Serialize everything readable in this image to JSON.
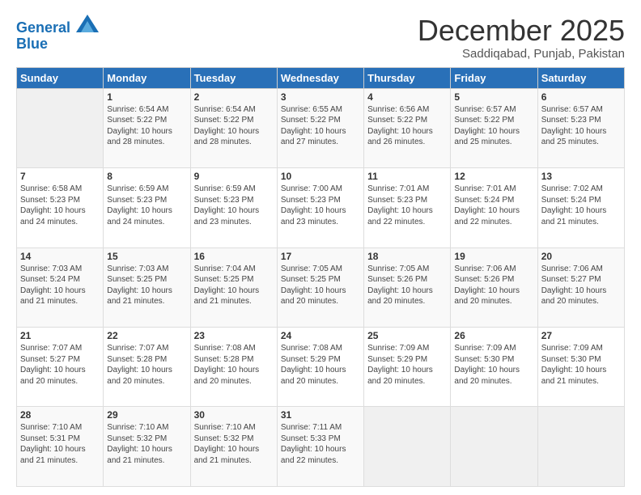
{
  "logo": {
    "line1": "General",
    "line2": "Blue"
  },
  "title": "December 2025",
  "subtitle": "Saddiqabad, Punjab, Pakistan",
  "weekdays": [
    "Sunday",
    "Monday",
    "Tuesday",
    "Wednesday",
    "Thursday",
    "Friday",
    "Saturday"
  ],
  "weeks": [
    [
      {
        "num": "",
        "content": ""
      },
      {
        "num": "1",
        "content": "Sunrise: 6:54 AM\nSunset: 5:22 PM\nDaylight: 10 hours\nand 28 minutes."
      },
      {
        "num": "2",
        "content": "Sunrise: 6:54 AM\nSunset: 5:22 PM\nDaylight: 10 hours\nand 28 minutes."
      },
      {
        "num": "3",
        "content": "Sunrise: 6:55 AM\nSunset: 5:22 PM\nDaylight: 10 hours\nand 27 minutes."
      },
      {
        "num": "4",
        "content": "Sunrise: 6:56 AM\nSunset: 5:22 PM\nDaylight: 10 hours\nand 26 minutes."
      },
      {
        "num": "5",
        "content": "Sunrise: 6:57 AM\nSunset: 5:22 PM\nDaylight: 10 hours\nand 25 minutes."
      },
      {
        "num": "6",
        "content": "Sunrise: 6:57 AM\nSunset: 5:23 PM\nDaylight: 10 hours\nand 25 minutes."
      }
    ],
    [
      {
        "num": "7",
        "content": "Sunrise: 6:58 AM\nSunset: 5:23 PM\nDaylight: 10 hours\nand 24 minutes."
      },
      {
        "num": "8",
        "content": "Sunrise: 6:59 AM\nSunset: 5:23 PM\nDaylight: 10 hours\nand 24 minutes."
      },
      {
        "num": "9",
        "content": "Sunrise: 6:59 AM\nSunset: 5:23 PM\nDaylight: 10 hours\nand 23 minutes."
      },
      {
        "num": "10",
        "content": "Sunrise: 7:00 AM\nSunset: 5:23 PM\nDaylight: 10 hours\nand 23 minutes."
      },
      {
        "num": "11",
        "content": "Sunrise: 7:01 AM\nSunset: 5:23 PM\nDaylight: 10 hours\nand 22 minutes."
      },
      {
        "num": "12",
        "content": "Sunrise: 7:01 AM\nSunset: 5:24 PM\nDaylight: 10 hours\nand 22 minutes."
      },
      {
        "num": "13",
        "content": "Sunrise: 7:02 AM\nSunset: 5:24 PM\nDaylight: 10 hours\nand 21 minutes."
      }
    ],
    [
      {
        "num": "14",
        "content": "Sunrise: 7:03 AM\nSunset: 5:24 PM\nDaylight: 10 hours\nand 21 minutes."
      },
      {
        "num": "15",
        "content": "Sunrise: 7:03 AM\nSunset: 5:25 PM\nDaylight: 10 hours\nand 21 minutes."
      },
      {
        "num": "16",
        "content": "Sunrise: 7:04 AM\nSunset: 5:25 PM\nDaylight: 10 hours\nand 21 minutes."
      },
      {
        "num": "17",
        "content": "Sunrise: 7:05 AM\nSunset: 5:25 PM\nDaylight: 10 hours\nand 20 minutes."
      },
      {
        "num": "18",
        "content": "Sunrise: 7:05 AM\nSunset: 5:26 PM\nDaylight: 10 hours\nand 20 minutes."
      },
      {
        "num": "19",
        "content": "Sunrise: 7:06 AM\nSunset: 5:26 PM\nDaylight: 10 hours\nand 20 minutes."
      },
      {
        "num": "20",
        "content": "Sunrise: 7:06 AM\nSunset: 5:27 PM\nDaylight: 10 hours\nand 20 minutes."
      }
    ],
    [
      {
        "num": "21",
        "content": "Sunrise: 7:07 AM\nSunset: 5:27 PM\nDaylight: 10 hours\nand 20 minutes."
      },
      {
        "num": "22",
        "content": "Sunrise: 7:07 AM\nSunset: 5:28 PM\nDaylight: 10 hours\nand 20 minutes."
      },
      {
        "num": "23",
        "content": "Sunrise: 7:08 AM\nSunset: 5:28 PM\nDaylight: 10 hours\nand 20 minutes."
      },
      {
        "num": "24",
        "content": "Sunrise: 7:08 AM\nSunset: 5:29 PM\nDaylight: 10 hours\nand 20 minutes."
      },
      {
        "num": "25",
        "content": "Sunrise: 7:09 AM\nSunset: 5:29 PM\nDaylight: 10 hours\nand 20 minutes."
      },
      {
        "num": "26",
        "content": "Sunrise: 7:09 AM\nSunset: 5:30 PM\nDaylight: 10 hours\nand 20 minutes."
      },
      {
        "num": "27",
        "content": "Sunrise: 7:09 AM\nSunset: 5:30 PM\nDaylight: 10 hours\nand 21 minutes."
      }
    ],
    [
      {
        "num": "28",
        "content": "Sunrise: 7:10 AM\nSunset: 5:31 PM\nDaylight: 10 hours\nand 21 minutes."
      },
      {
        "num": "29",
        "content": "Sunrise: 7:10 AM\nSunset: 5:32 PM\nDaylight: 10 hours\nand 21 minutes."
      },
      {
        "num": "30",
        "content": "Sunrise: 7:10 AM\nSunset: 5:32 PM\nDaylight: 10 hours\nand 21 minutes."
      },
      {
        "num": "31",
        "content": "Sunrise: 7:11 AM\nSunset: 5:33 PM\nDaylight: 10 hours\nand 22 minutes."
      },
      {
        "num": "",
        "content": ""
      },
      {
        "num": "",
        "content": ""
      },
      {
        "num": "",
        "content": ""
      }
    ]
  ]
}
